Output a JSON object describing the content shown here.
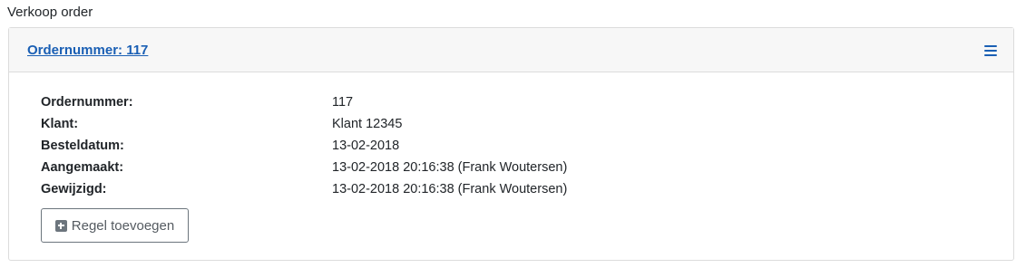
{
  "page": {
    "title": "Verkoop order"
  },
  "card": {
    "header_link": "Ordernummer: 117",
    "menu_icon": "hamburger-menu-icon"
  },
  "details": [
    {
      "label": "Ordernummer:",
      "value": "117"
    },
    {
      "label": "Klant:",
      "value": "Klant 12345"
    },
    {
      "label": "Besteldatum:",
      "value": "13-02-2018"
    },
    {
      "label": "Aangemaakt:",
      "value": "13-02-2018 20:16:38 (Frank Woutersen)"
    },
    {
      "label": "Gewijzigd:",
      "value": "13-02-2018 20:16:38 (Frank Woutersen)"
    }
  ],
  "actions": {
    "add_line_label": "Regel toevoegen",
    "add_line_icon": "plus-square-icon"
  },
  "colors": {
    "link": "#1a5fb4",
    "header_bg": "#f7f7f7",
    "border": "#dcdcdc",
    "button_border": "#6c757d"
  }
}
